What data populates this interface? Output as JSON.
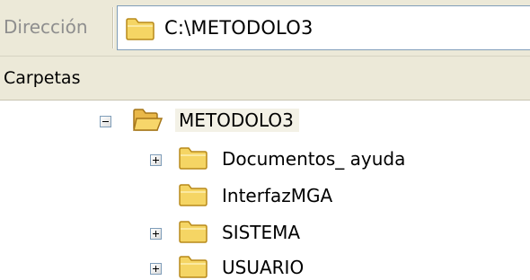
{
  "address": {
    "label": "Dirección",
    "value": "C:\\METODOLO3",
    "icon": "folder-icon"
  },
  "pane": {
    "title": "Carpetas"
  },
  "tree": {
    "root": {
      "label": "METODOLO3",
      "expanded": true,
      "icon": "open-folder-icon"
    },
    "children": [
      {
        "label": "Documentos_ ayuda",
        "expandable": true,
        "icon": "folder-icon"
      },
      {
        "label": "InterfazMGA",
        "expandable": false,
        "icon": "folder-icon"
      },
      {
        "label": "SISTEMA",
        "expandable": true,
        "icon": "folder-icon"
      },
      {
        "label": "USUARIO",
        "expandable": true,
        "icon": "folder-icon"
      }
    ]
  },
  "colors": {
    "toolbar_bg": "#ece9d8",
    "folder_yellow": "#f5d564",
    "folder_outline": "#b88a1a",
    "field_border": "#7f9db9"
  }
}
